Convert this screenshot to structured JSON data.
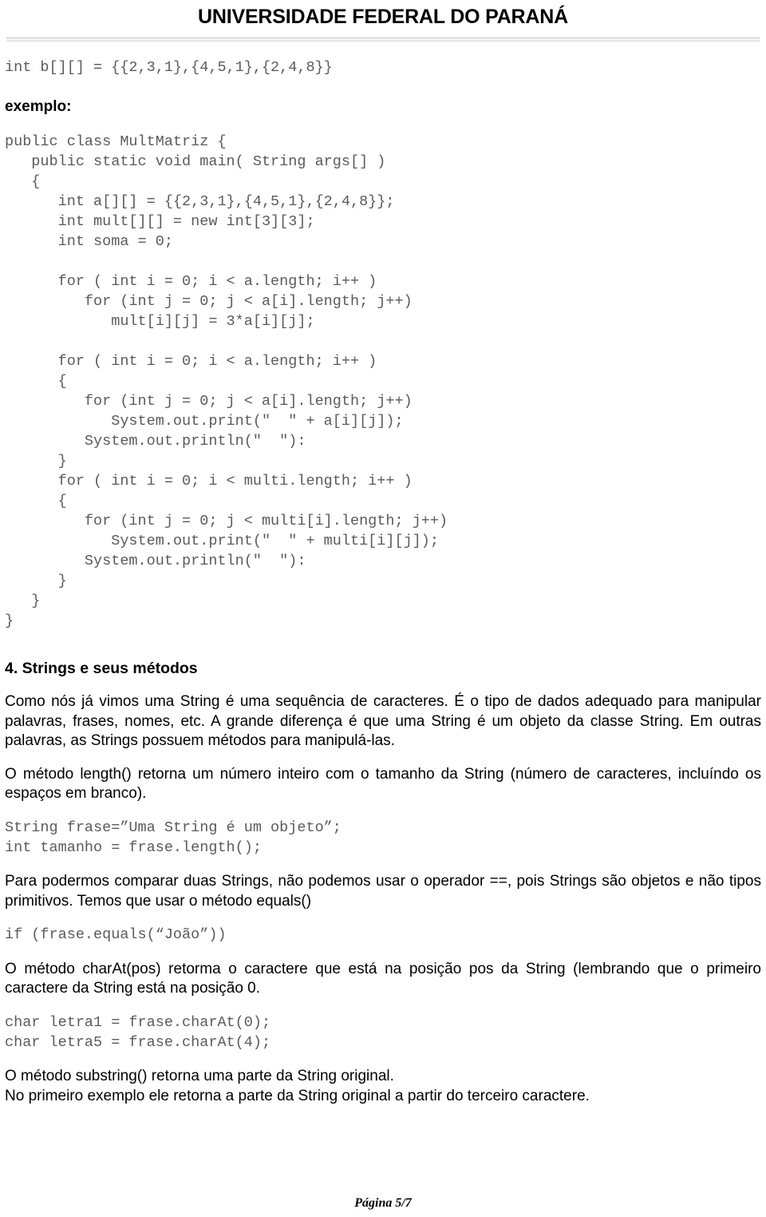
{
  "header": {
    "title": "UNIVERSIDADE FEDERAL DO PARANÁ"
  },
  "code_top": "int b[][] = {{2,3,1},{4,5,1},{2,4,8}}",
  "label_exemplo": "exemplo:",
  "code_main": "public class MultMatriz {\n   public static void main( String args[] )\n   {\n      int a[][] = {{2,3,1},{4,5,1},{2,4,8}};\n      int mult[][] = new int[3][3];\n      int soma = 0;\n\n      for ( int i = 0; i < a.length; i++ )\n         for (int j = 0; j < a[i].length; j++)\n            mult[i][j] = 3*a[i][j];\n\n      for ( int i = 0; i < a.length; i++ )\n      {\n         for (int j = 0; j < a[i].length; j++)\n            System.out.print(\"  \" + a[i][j]);\n         System.out.println(\"  \"):\n      }\n      for ( int i = 0; i < multi.length; i++ )\n      {\n         for (int j = 0; j < multi[i].length; j++)\n            System.out.print(\"  \" + multi[i][j]);\n         System.out.println(\"  \"):\n      }\n   }\n}",
  "section": {
    "number_title": "4. Strings e seus métodos",
    "paragraph_1": "Como nós já vimos uma String é uma sequência de caracteres. É o tipo de dados adequado para manipular palavras, frases, nomes, etc. A grande diferença é que uma String é um objeto da classe String. Em outras palavras, as Strings possuem métodos para manipulá-las.",
    "paragraph_2": "O método length() retorna um número inteiro com o tamanho da String (número de caracteres, incluíndo os espaços em branco).",
    "code_length": "String frase=”Uma String é um objeto”;\nint tamanho = frase.length();",
    "paragraph_3": "Para podermos comparar duas Strings, não podemos usar o operador ==, pois Strings são objetos e não tipos primitivos. Temos que usar o método equals()",
    "code_equals": "if (frase.equals(“João”))",
    "paragraph_4": "O método charAt(pos) retorma o caractere que está na posição pos da String (lembrando que o primeiro caractere da String está na posição 0.",
    "code_charat": "char letra1 = frase.charAt(0);\nchar letra5 = frase.charAt(4);",
    "paragraph_5_line1": "O método substring() retorna uma parte da String original.",
    "paragraph_5_line2": "No primeiro exemplo ele retorna a parte da String original a partir do terceiro caractere."
  },
  "footer": {
    "page_label": "Página 5/7"
  },
  "colors": {
    "text": "#000000",
    "code_text": "#5b5b5b",
    "rule": "#c9c9c9",
    "background": "#ffffff"
  }
}
